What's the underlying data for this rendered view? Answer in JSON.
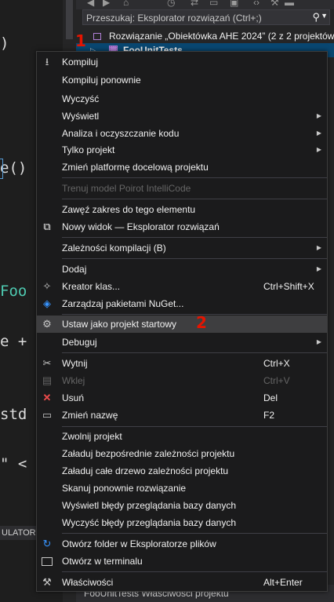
{
  "editor": {
    "lines": [
      ")",
      "e()",
      "Foo",
      "e +",
      "std",
      "\" <"
    ],
    "bottom_tab": "ULATORY"
  },
  "solution_explorer": {
    "search_placeholder": "Przeszukaj: Eksplorator rozwiązań (Ctrl+;)",
    "search_icon": "search-icon",
    "solution_label": "Rozwiązanie „Obiektówka AHE 2024” (2 z 2 projektów)",
    "project_label": "FooUnitTests",
    "status_bar": "FooUnitTests  Właściwości projektu"
  },
  "annotations": {
    "mark_one": "1",
    "mark_two": "2",
    "color": "#e51400"
  },
  "menu": {
    "items": [
      {
        "label": "Kompiluj",
        "icon": "build-icon"
      },
      {
        "label": "Kompiluj ponownie"
      },
      {
        "label": "Wyczyść"
      },
      {
        "label": "Wyświetl",
        "submenu": true
      },
      {
        "label": "Analiza i oczyszczanie kodu",
        "submenu": true
      },
      {
        "label": "Tylko projekt",
        "submenu": true
      },
      {
        "label": "Zmień platformę docelową projektu"
      },
      {
        "label": "Trenuj model Poirot IntelliCode",
        "disabled": true
      },
      {
        "label": "Zawęź zakres do tego elementu"
      },
      {
        "label": "Nowy widok — Eksplorator rozwiązań",
        "icon": "new-view-icon"
      },
      {
        "label": "Zależności kompilacji (B)",
        "submenu": true
      },
      {
        "label": "Dodaj",
        "submenu": true
      },
      {
        "label": "Kreator klas...",
        "icon": "class-wizard-icon",
        "shortcut": "Ctrl+Shift+X"
      },
      {
        "label": "Zarządzaj pakietami NuGet...",
        "icon": "nuget-icon"
      },
      {
        "label": "Ustaw jako projekt startowy",
        "icon": "gear-icon",
        "highlighted": true
      },
      {
        "label": "Debuguj",
        "submenu": true
      },
      {
        "label": "Wytnij",
        "icon": "scissors-icon",
        "shortcut": "Ctrl+X"
      },
      {
        "label": "Wklej",
        "icon": "paste-icon",
        "shortcut": "Ctrl+V",
        "disabled": true
      },
      {
        "label": "Usuń",
        "icon": "delete-icon",
        "shortcut": "Del"
      },
      {
        "label": "Zmień nazwę",
        "icon": "rename-icon",
        "shortcut": "F2"
      },
      {
        "label": "Zwolnij projekt"
      },
      {
        "label": "Załaduj bezpośrednie zależności projektu"
      },
      {
        "label": "Załaduj całe drzewo zależności projektu"
      },
      {
        "label": "Skanuj ponownie rozwiązanie"
      },
      {
        "label": "Wyświetl błędy przeglądania bazy danych"
      },
      {
        "label": "Wyczyść błędy przeglądania bazy danych"
      },
      {
        "label": "Otwórz folder w Eksploratorze plików",
        "icon": "folder-refresh-icon"
      },
      {
        "label": "Otwórz w terminalu",
        "icon": "terminal-icon"
      },
      {
        "label": "Właściwości",
        "icon": "wrench-icon",
        "shortcut": "Alt+Enter"
      }
    ]
  }
}
